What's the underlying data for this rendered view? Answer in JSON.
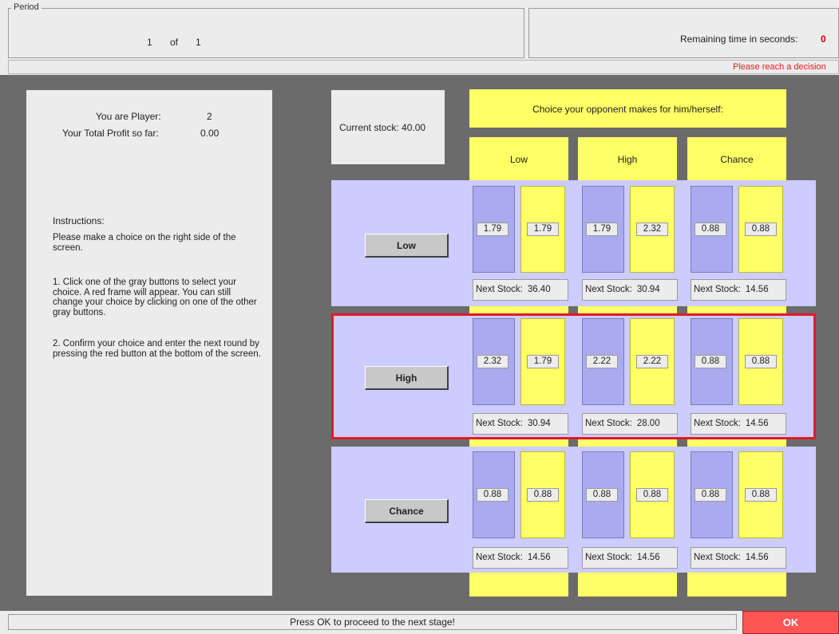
{
  "header": {
    "period_legend": "Period",
    "period_current": "1",
    "period_of": "of",
    "period_total": "1",
    "remaining_label": "Remaining time in seconds:",
    "remaining_value": "0",
    "decision_message": "Please reach a decision"
  },
  "player": {
    "player_label": "You are Player:",
    "player_value": "2",
    "profit_label": "Your Total Profit so far:",
    "profit_value": "0.00"
  },
  "instructions": {
    "heading": "Instructions:",
    "p1": "Please make a choice on the right side of the screen.",
    "p2": "1. Click one of the gray buttons to select your choice. A red frame will appear. You can still change your choice by clicking on one of the other gray buttons.",
    "p3": "2. Confirm your choice and enter the next round by pressing the red button at the bottom of the screen."
  },
  "stock": {
    "label": "Current stock:",
    "value": "40.00"
  },
  "opponent": {
    "header": "Choice your opponent makes for him/herself:",
    "columns": [
      "Low",
      "High",
      "Chance"
    ]
  },
  "next_stock_label": "Next Stock:",
  "rows": [
    {
      "button": "Low",
      "cells": [
        {
          "mine": "1.79",
          "theirs": "1.79",
          "next": "36.40"
        },
        {
          "mine": "1.79",
          "theirs": "2.32",
          "next": "30.94"
        },
        {
          "mine": "0.88",
          "theirs": "0.88",
          "next": "14.56"
        }
      ]
    },
    {
      "button": "High",
      "selected": true,
      "cells": [
        {
          "mine": "2.32",
          "theirs": "1.79",
          "next": "30.94"
        },
        {
          "mine": "2.22",
          "theirs": "2.22",
          "next": "28.00"
        },
        {
          "mine": "0.88",
          "theirs": "0.88",
          "next": "14.56"
        }
      ]
    },
    {
      "button": "Chance",
      "cells": [
        {
          "mine": "0.88",
          "theirs": "0.88",
          "next": "14.56"
        },
        {
          "mine": "0.88",
          "theirs": "0.88",
          "next": "14.56"
        },
        {
          "mine": "0.88",
          "theirs": "0.88",
          "next": "14.56"
        }
      ]
    }
  ],
  "footer": {
    "message": "Press OK to proceed to the next stage!",
    "ok_label": "OK"
  },
  "colors": {
    "background": "#6b6b6b",
    "panel": "#ececec",
    "row_panel": "#ccccff",
    "own_cell": "#aaaaf0",
    "opponent_cell": "#ffff66",
    "selection_frame": "#e01a2a",
    "ok_button": "#ff5555",
    "alert_text": "#e02020"
  }
}
